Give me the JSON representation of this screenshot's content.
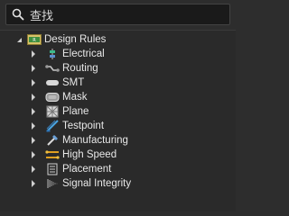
{
  "search": {
    "value": "查找"
  },
  "tree": {
    "root": {
      "label": "Design Rules",
      "icon": "design-rules-icon"
    },
    "items": [
      {
        "label": "Electrical",
        "icon": "electrical-icon"
      },
      {
        "label": "Routing",
        "icon": "routing-icon"
      },
      {
        "label": "SMT",
        "icon": "smt-icon"
      },
      {
        "label": "Mask",
        "icon": "mask-icon"
      },
      {
        "label": "Plane",
        "icon": "plane-icon"
      },
      {
        "label": "Testpoint",
        "icon": "testpoint-icon"
      },
      {
        "label": "Manufacturing",
        "icon": "manufacturing-icon"
      },
      {
        "label": "High Speed",
        "icon": "high-speed-icon"
      },
      {
        "label": "Placement",
        "icon": "placement-icon"
      },
      {
        "label": "Signal Integrity",
        "icon": "signal-integrity-icon"
      }
    ]
  }
}
